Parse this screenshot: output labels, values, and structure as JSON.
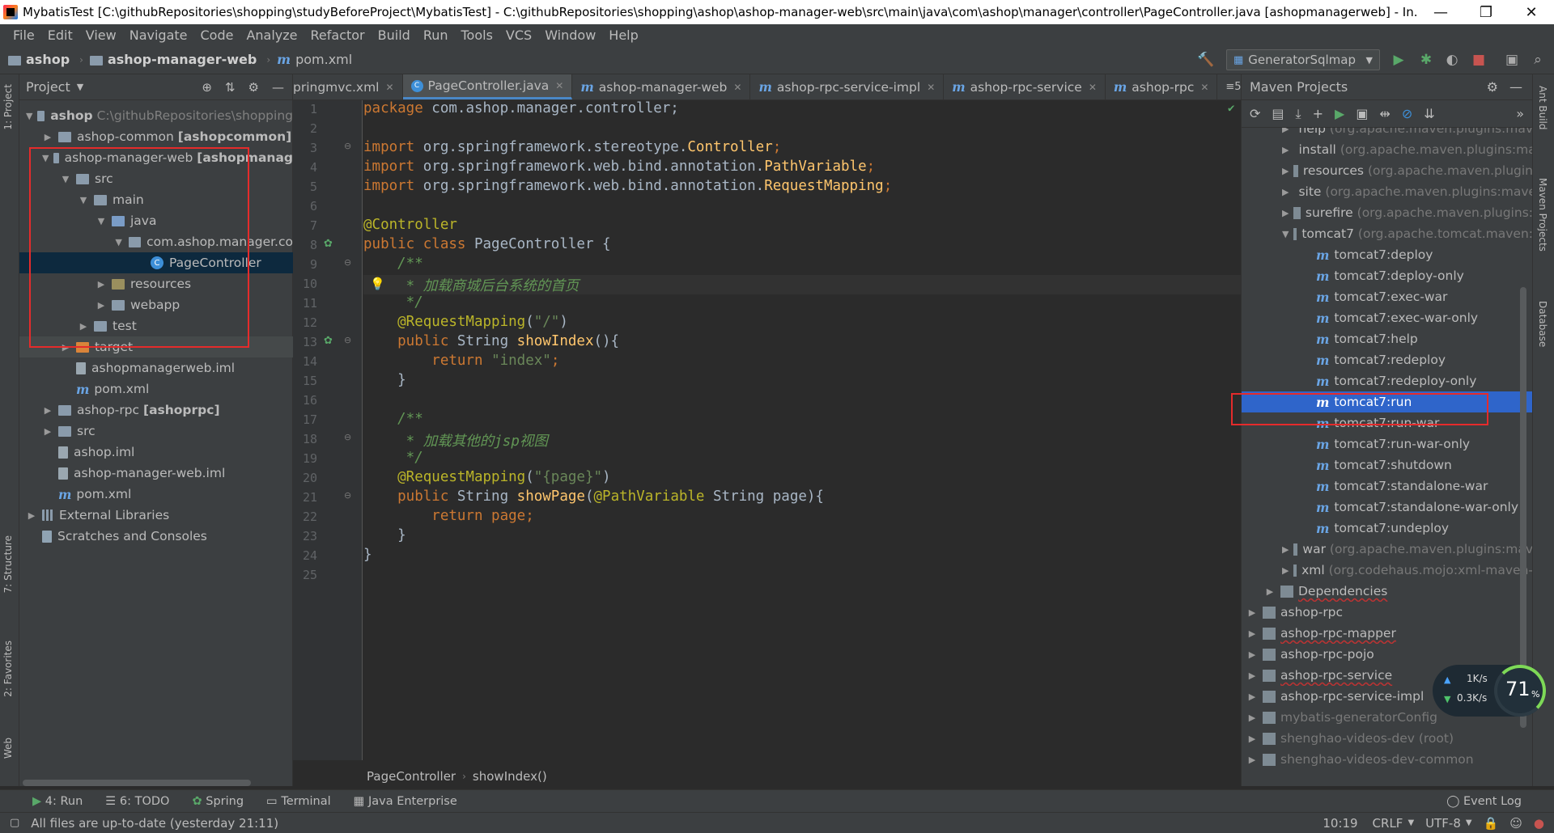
{
  "window": {
    "title": "MybatisTest [C:\\githubRepositories\\shopping\\studyBeforeProject\\MybatisTest] - C:\\githubRepositories\\shopping\\ashop\\ashop-manager-web\\src\\main\\java\\com\\ashop\\manager\\controller\\PageController.java [ashopmanagerweb] - In...",
    "minimize": "—",
    "maximize": "❐",
    "close": "✕"
  },
  "menu": [
    "File",
    "Edit",
    "View",
    "Navigate",
    "Code",
    "Analyze",
    "Refactor",
    "Build",
    "Run",
    "Tools",
    "VCS",
    "Window",
    "Help"
  ],
  "nav": {
    "crumb1": "ashop",
    "crumb2": "ashop-manager-web",
    "crumb3": "pom.xml",
    "run_config": "GeneratorSqlmap"
  },
  "left_strip": {
    "project": "1: Project",
    "structure": "7: Structure",
    "favorites": "2: Favorites",
    "web": "Web"
  },
  "project_panel": {
    "title": "Project",
    "rows": [
      {
        "name": "ashop",
        "extra": "C:\\githubRepositories\\shopping"
      },
      {
        "name": "ashop-common",
        "extra": "[ashopcommon]"
      },
      {
        "name": "ashop-manager-web",
        "extra": "[ashopmanag"
      },
      {
        "name": "src"
      },
      {
        "name": "main"
      },
      {
        "name": "java"
      },
      {
        "name": "com.ashop.manager.co"
      },
      {
        "name": "PageController"
      },
      {
        "name": "resources"
      },
      {
        "name": "webapp"
      },
      {
        "name": "test"
      },
      {
        "name": "target"
      },
      {
        "name": "ashopmanagerweb.iml"
      },
      {
        "name": "pom.xml"
      },
      {
        "name": "ashop-rpc",
        "extra": "[ashoprpc]"
      },
      {
        "name": "src"
      },
      {
        "name": "ashop.iml"
      },
      {
        "name": "ashop-manager-web.iml"
      },
      {
        "name": "pom.xml"
      },
      {
        "name": "External Libraries"
      },
      {
        "name": "Scratches and Consoles"
      }
    ]
  },
  "tabs": [
    {
      "label": "pringmvc.xml"
    },
    {
      "label": "PageController.java"
    },
    {
      "label": "ashop-manager-web"
    },
    {
      "label": "ashop-rpc-service-impl"
    },
    {
      "label": "ashop-rpc-service"
    },
    {
      "label": "ashop-rpc"
    }
  ],
  "tab_overflow": "≡5",
  "code": {
    "line_numbers": [
      "1",
      "2",
      "3",
      "4",
      "5",
      "6",
      "7",
      "8",
      "9",
      "10",
      "11",
      "12",
      "13",
      "14",
      "15",
      "16",
      "17",
      "18",
      "19",
      "20",
      "21",
      "22",
      "23",
      "24",
      "25"
    ],
    "l1_kw": "package",
    "l1_rest": " com.ashop.manager.controller;",
    "l3_kw": "import",
    "l3_rest": " org.springframework.stereotype.",
    "l3_cls": "Controller",
    "l3_end": ";",
    "l4_kw": "import",
    "l4_rest": " org.springframework.web.bind.annotation.",
    "l4_cls": "PathVariable",
    "l4_end": ";",
    "l5_kw": "import",
    "l5_rest": " org.springframework.web.bind.annotation.",
    "l5_cls": "RequestMapping",
    "l5_end": ";",
    "l7": "@Controller",
    "l8_kw": "public class",
    "l8_rest": " PageController {",
    "l9": "    /**",
    "l10": "     * 加载商城后台系统的首页",
    "l11": "     */",
    "l12_ann": "    @RequestMapping",
    "l12_p1": "(",
    "l12_str": "\"/\"",
    "l12_p2": ")",
    "l13_kw": "    public",
    "l13_mid": " String ",
    "l13_fn": "showIndex",
    "l13_end": "(){",
    "l14_kw": "        return",
    "l14_sp": " ",
    "l14_str": "\"index\"",
    "l14_end": ";",
    "l15": "    }",
    "l17": "    /**",
    "l18": "     * 加载其他的jsp视图",
    "l19": "     */",
    "l20_ann": "    @RequestMapping",
    "l20_p1": "(",
    "l20_str": "\"{page}\"",
    "l20_p2": ")",
    "l21_kw": "    public",
    "l21_mid": " String ",
    "l21_fn": "showPage",
    "l21_p": "(",
    "l21_ann": "@PathVariable",
    "l21_end": " String page){",
    "l22_kw": "        return",
    "l22_end": " page;",
    "l23": "    }",
    "l24": "}"
  },
  "editor_breadcrumb": {
    "cls": "PageController",
    "method": "showIndex()"
  },
  "maven": {
    "title": "Maven Projects",
    "rows": [
      {
        "name": "help",
        "extra": "(org.apache.maven.plugins:mav"
      },
      {
        "name": "install",
        "extra": "(org.apache.maven.plugins:ma"
      },
      {
        "name": "resources",
        "extra": "(org.apache.maven.plugin"
      },
      {
        "name": "site",
        "extra": "(org.apache.maven.plugins:mave"
      },
      {
        "name": "surefire",
        "extra": "(org.apache.maven.plugins:"
      },
      {
        "name": "tomcat7",
        "extra": "(org.apache.tomcat.maven:"
      },
      {
        "name": "tomcat7:deploy"
      },
      {
        "name": "tomcat7:deploy-only"
      },
      {
        "name": "tomcat7:exec-war"
      },
      {
        "name": "tomcat7:exec-war-only"
      },
      {
        "name": "tomcat7:help"
      },
      {
        "name": "tomcat7:redeploy"
      },
      {
        "name": "tomcat7:redeploy-only"
      },
      {
        "name": "tomcat7:run"
      },
      {
        "name": "tomcat7:run-war"
      },
      {
        "name": "tomcat7:run-war-only"
      },
      {
        "name": "tomcat7:shutdown"
      },
      {
        "name": "tomcat7:standalone-war"
      },
      {
        "name": "tomcat7:standalone-war-only"
      },
      {
        "name": "tomcat7:undeploy"
      },
      {
        "name": "war",
        "extra": "(org.apache.maven.plugins:mav"
      },
      {
        "name": "xml",
        "extra": "(org.codehaus.mojo:xml-maven-"
      },
      {
        "name": "Dependencies"
      },
      {
        "name": "ashop-rpc"
      },
      {
        "name": "ashop-rpc-mapper"
      },
      {
        "name": "ashop-rpc-pojo"
      },
      {
        "name": "ashop-rpc-service"
      },
      {
        "name": "ashop-rpc-service-impl"
      },
      {
        "name": "mybatis-generatorConfig"
      },
      {
        "name": "shenghao-videos-dev (root)"
      },
      {
        "name": "shenghao-videos-dev-common"
      }
    ]
  },
  "right_strip": {
    "ant": "Ant Build",
    "maven": "Maven Projects",
    "db": "Database"
  },
  "bottom_tools": [
    {
      "label": "4: Run"
    },
    {
      "label": "6: TODO"
    },
    {
      "label": "Spring"
    },
    {
      "label": "Terminal"
    },
    {
      "label": "Java Enterprise"
    }
  ],
  "event_log": "Event Log",
  "status": {
    "message": "All files are up-to-date (yesterday 21:11)",
    "position": "10:19",
    "line_sep": "CRLF",
    "encoding": "UTF-8"
  },
  "net_widget": {
    "up": "1K/s",
    "down": "0.3K/s",
    "percent": "71",
    "unit": "%"
  }
}
